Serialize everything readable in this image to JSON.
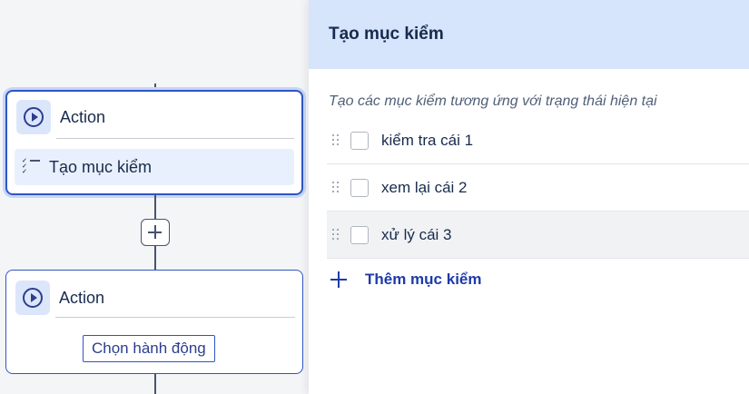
{
  "canvas": {
    "top_card": {
      "action_label": "Action",
      "step_label": "Tạo mục kiểm"
    },
    "bottom_card": {
      "action_label": "Action",
      "choose_button": "Chọn hành động"
    }
  },
  "panel": {
    "title": "Tạo mục kiểm",
    "description": "Tạo các mục kiểm tương ứng với trạng thái hiện tại",
    "items": [
      {
        "label": "kiểm tra cái 1",
        "checked": false
      },
      {
        "label": "xem lại cái 2",
        "checked": false
      },
      {
        "label": "xử lý cái 3",
        "checked": false
      }
    ],
    "add_label": "Thêm mục kiểm"
  },
  "colors": {
    "accent": "#2f55c6",
    "header_bg": "#d6e4fc",
    "link": "#1f3aa8"
  },
  "icons": {
    "action": "play-circle-icon",
    "step": "checklist-icon",
    "add": "plus-icon",
    "drag": "drag-handle-icon"
  }
}
